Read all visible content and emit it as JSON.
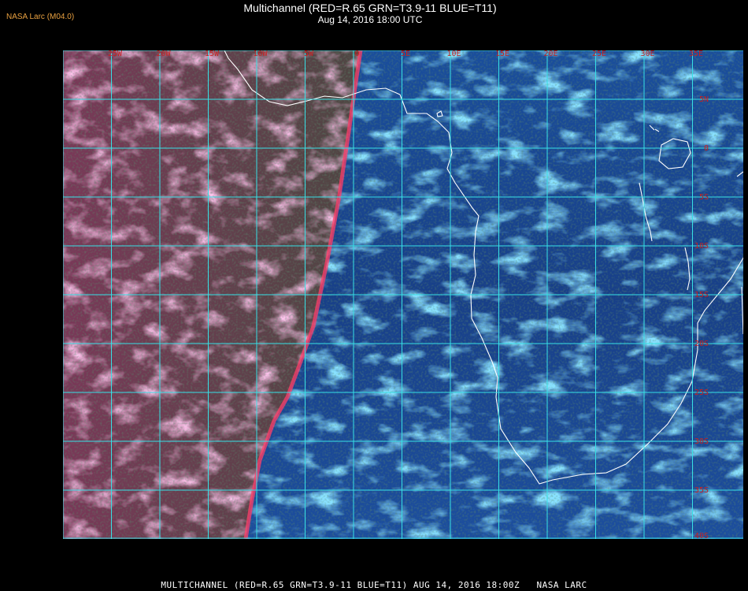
{
  "header": {
    "org": "NASA Larc (M04.0)",
    "title": "Multichannel (RED=R.65 GRN=T3.9-11 BLUE=T11)",
    "datetime": "Aug 14, 2016 18:00 UTC"
  },
  "map": {
    "longitude_labels": [
      "25W",
      "20W",
      "15W",
      "10W",
      "5W",
      "0",
      "5E",
      "10E",
      "15E",
      "20E",
      "25E",
      "30E",
      "35E"
    ],
    "latitude_labels": [
      "5N",
      "0",
      "5S",
      "10S",
      "15S",
      "20S",
      "25S",
      "30S",
      "35S",
      "40S"
    ],
    "grid_color": "#37e0e6",
    "label_color": "#c82020",
    "coastline_color": "#ffffff"
  },
  "footer": {
    "caption": "MULTICHANNEL (RED=R.65 GRN=T3.9-11 BLUE=T11) AUG 14, 2016 18:00Z   NASA LARC"
  }
}
